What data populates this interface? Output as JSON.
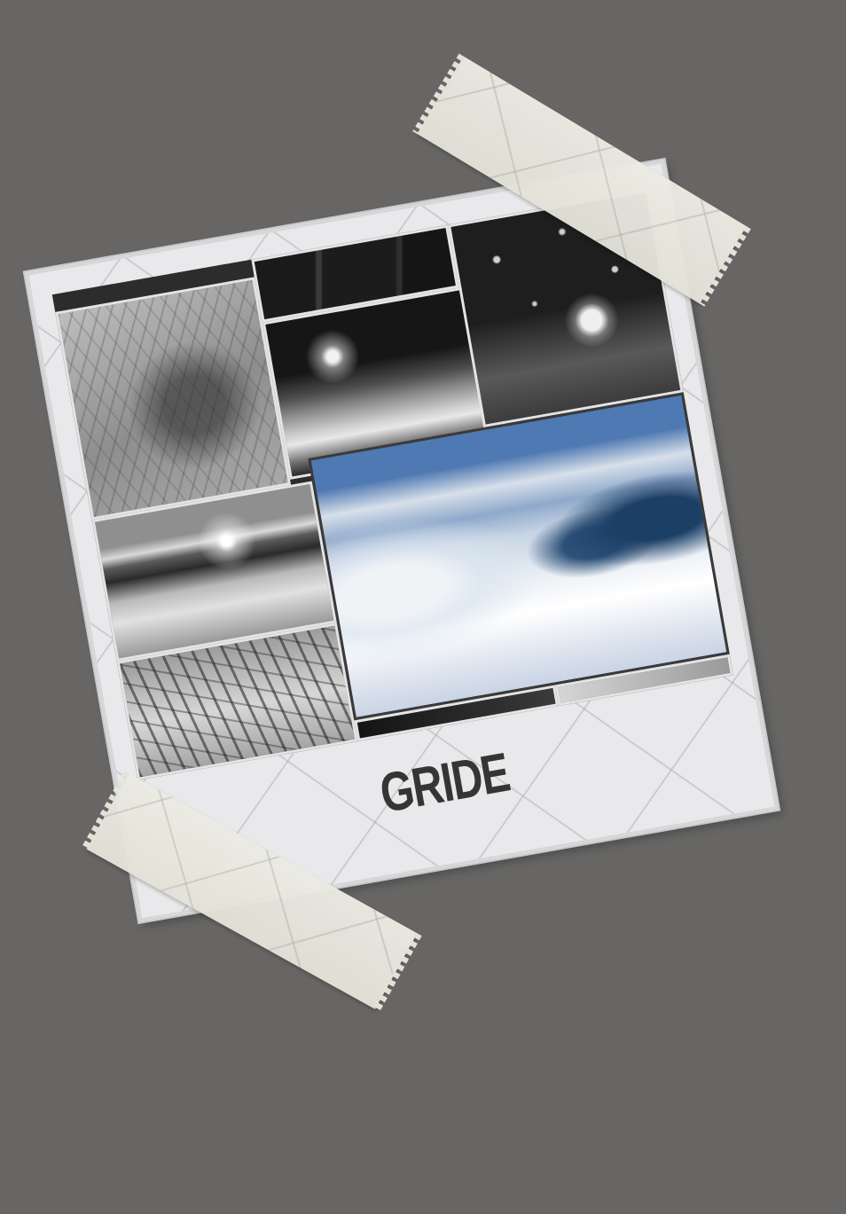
{
  "poster": {
    "caption": "GRIDE",
    "colors": {
      "background": "#676665",
      "card": "#e9e9ec",
      "tape": "#ecebe3",
      "caption_text": "#353535"
    },
    "photos": [
      "tree-shadow-photo",
      "coat-detail-photo",
      "snowy-mountain-photo",
      "snowfall-night-photo",
      "frozen-lake-sunset-photo",
      "frosted-branches-photo",
      "snowy-forest-color-photo"
    ]
  }
}
